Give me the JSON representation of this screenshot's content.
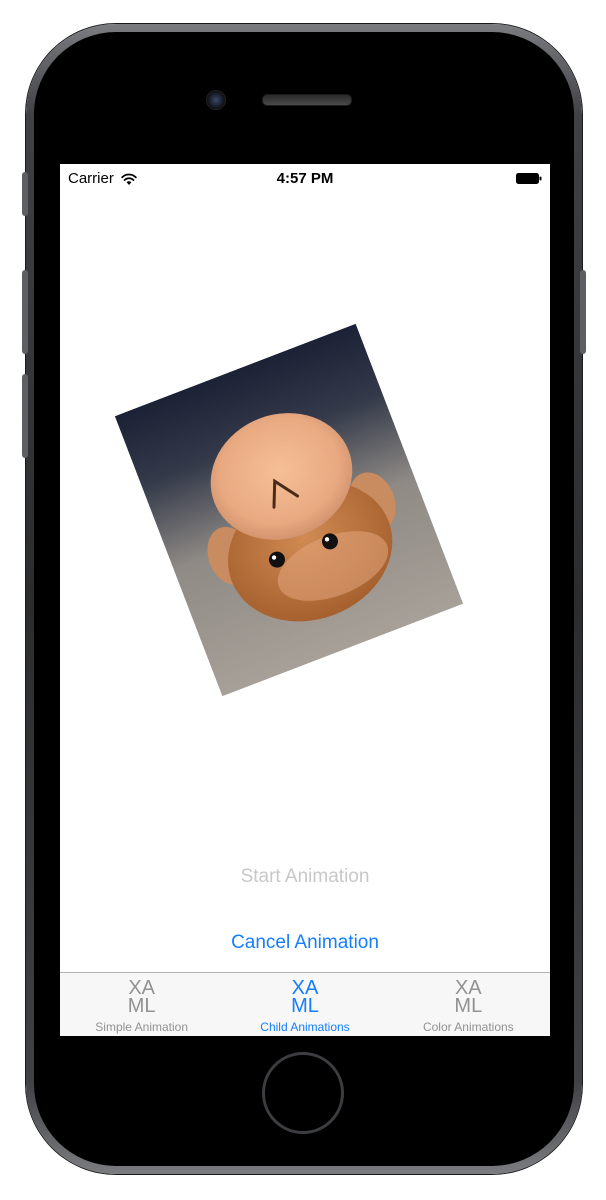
{
  "status_bar": {
    "carrier": "Carrier",
    "time": "4:57 PM"
  },
  "main": {
    "start_label": "Start Animation",
    "cancel_label": "Cancel Animation",
    "image_icon": "monkey-photo"
  },
  "tabs": [
    {
      "icon_line1": "XA",
      "icon_line2": "ML",
      "label": "Simple Animation",
      "active": false
    },
    {
      "icon_line1": "XA",
      "icon_line2": "ML",
      "label": "Child Animations",
      "active": true
    },
    {
      "icon_line1": "XA",
      "icon_line2": "ML",
      "label": "Color Animations",
      "active": false
    }
  ],
  "colors": {
    "accent": "#157efb",
    "inactive_tab": "#929292",
    "disabled_button": "#c8c8c8"
  }
}
